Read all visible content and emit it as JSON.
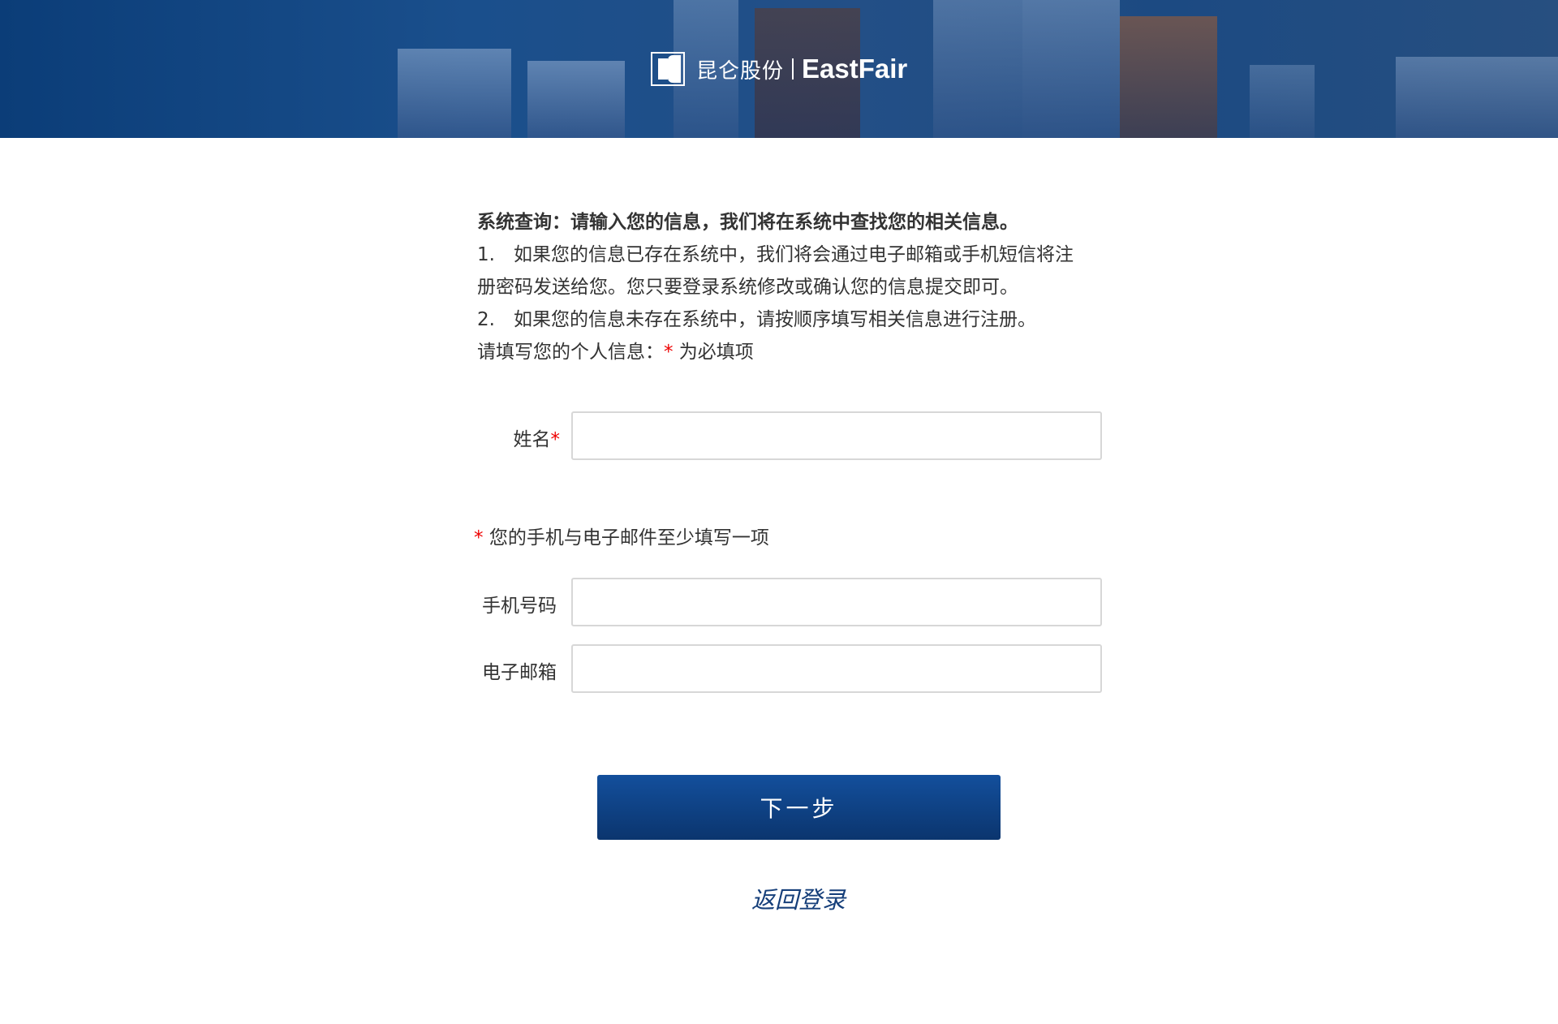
{
  "header": {
    "logo_cn": "昆仑股份",
    "logo_en": "EastFair"
  },
  "intro": {
    "title": "系统查询：请输入您的信息，我们将在系统中查找您的相关信息。",
    "line1a": "1.　如果您的信息已存在系统中，我们将会通过电子邮箱或手机短信将注",
    "line1b": "册密码发送给您。您只要登录系统修改或确认您的信息提交即可。",
    "line2": "2.　如果您的信息未存在系统中，请按顺序填写相关信息进行注册。",
    "required_prefix": "请填写您的个人信息：",
    "required_mark": "*",
    "required_suffix": " 为必填项"
  },
  "form": {
    "name_label": "姓名",
    "name_value": "",
    "required_mark": "*",
    "contact_note": "您的手机与电子邮件至少填写一项",
    "phone_label": "手机号码",
    "phone_value": "",
    "email_label": "电子邮箱",
    "email_value": ""
  },
  "actions": {
    "next_label": "下一步",
    "back_login_label": "返回登录"
  },
  "colors": {
    "primary": "#0e4185",
    "required": "#e00000",
    "link": "#163f7a"
  }
}
